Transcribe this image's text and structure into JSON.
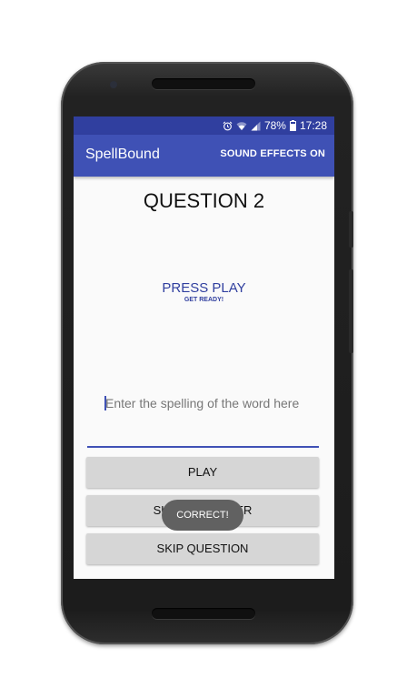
{
  "status_bar": {
    "battery": "78%",
    "time": "17:28"
  },
  "app_bar": {
    "title": "SpellBound",
    "action_label": "SOUND EFFECTS ON"
  },
  "quiz": {
    "question_title": "QUESTION 2",
    "prompt_main": "PRESS PLAY",
    "prompt_sub": "GET READY!"
  },
  "spelling_input": {
    "value": "",
    "placeholder": "Enter the spelling of the word here"
  },
  "buttons": {
    "play": "PLAY",
    "submit": "SUBMIT ANSWER",
    "skip": "SKIP QUESTION"
  },
  "toast": {
    "message": "CORRECT!"
  },
  "colors": {
    "status_bar": "#303f9f",
    "app_bar": "#3f51b5",
    "accent": "#303f9f",
    "button": "#d6d6d6",
    "toast": "#616161"
  },
  "icons": [
    "alarm-icon",
    "wifi-icon",
    "signal-icon",
    "battery-icon"
  ]
}
